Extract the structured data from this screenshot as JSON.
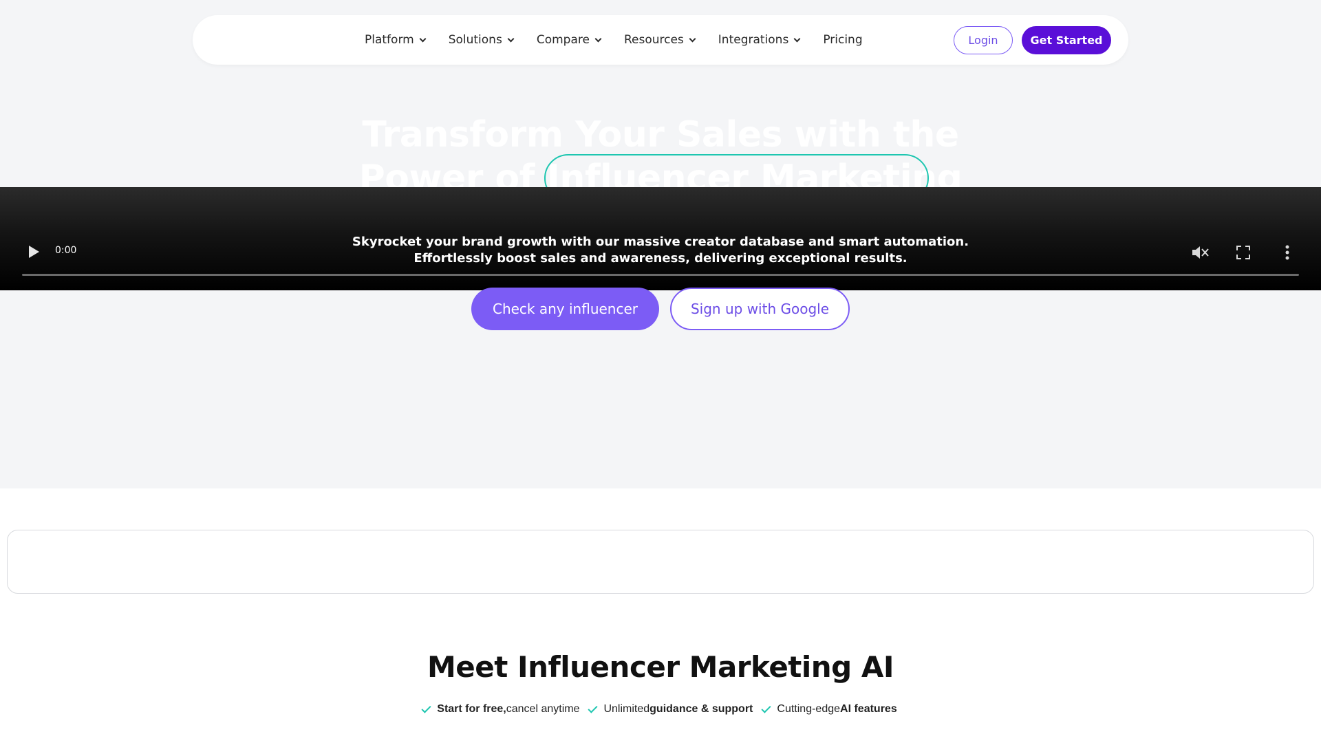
{
  "nav": {
    "items": [
      {
        "label": "Platform",
        "dropdown": true
      },
      {
        "label": "Solutions",
        "dropdown": true
      },
      {
        "label": "Compare",
        "dropdown": true
      },
      {
        "label": "Resources",
        "dropdown": true
      },
      {
        "label": "Integrations",
        "dropdown": true
      },
      {
        "label": "Pricing",
        "dropdown": false
      }
    ],
    "login": "Login",
    "get_started": "Get Started"
  },
  "hero": {
    "headline_line1": "Transform Your Sales with the",
    "headline_line2_a": "Power of ",
    "headline_line2_b": "Influencer Marketing",
    "subtitle_line1": "Skyrocket your brand growth with our massive creator database and smart automation.",
    "subtitle_line2": "Effortlessly boost sales and awareness, delivering exceptional results.",
    "cta_primary": "Check any influencer",
    "cta_secondary": "Sign up with Google"
  },
  "video": {
    "time": "0:00",
    "progress": 0,
    "muted": true
  },
  "section": {
    "title": "Meet Influencer Marketing AI",
    "features": [
      {
        "bold_first": "Start for free,",
        "rest": " cancel anytime"
      },
      {
        "plain_first": "Unlimited ",
        "bold": "guidance & support"
      },
      {
        "plain_first": "Cutting-edge ",
        "bold": "AI features"
      }
    ]
  },
  "colors": {
    "accent_purple": "#7c5cf5",
    "dark_purple": "#5a0fd8",
    "teal": "#1ec6b0",
    "hero_bg": "#f4f5f7"
  }
}
